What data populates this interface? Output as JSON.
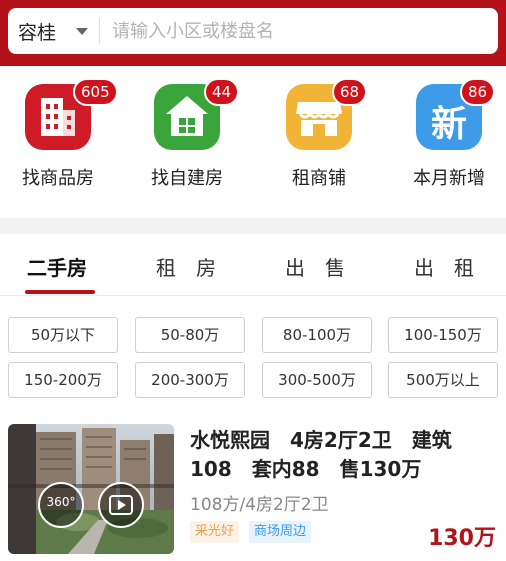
{
  "search": {
    "city": "容桂",
    "placeholder": "请输入小区或楼盘名"
  },
  "categories": [
    {
      "label": "找商品房",
      "count": "605",
      "icon": "building-icon",
      "color": "#cf1b25"
    },
    {
      "label": "找自建房",
      "count": "44",
      "icon": "house-icon",
      "color": "#3aa53b"
    },
    {
      "label": "租商铺",
      "count": "68",
      "icon": "shop-icon",
      "color": "#f1b437"
    },
    {
      "label": "本月新增",
      "count": "86",
      "icon": "new-icon",
      "color": "#3d9be8",
      "icon_text": "新"
    }
  ],
  "tabs": [
    {
      "label": "二手房",
      "active": true
    },
    {
      "label": "租　房"
    },
    {
      "label": "出　售"
    },
    {
      "label": "出　租"
    }
  ],
  "price_filters": [
    "50万以下",
    "50-80万",
    "80-100万",
    "100-150万",
    "150-200万",
    "200-300万",
    "300-500万",
    "500万以上"
  ],
  "listing": {
    "title": "水悦熙园　4房2厅2卫　建筑108　套内88　售130万",
    "subtitle": "108方/4房2厅2卫",
    "tags": [
      {
        "text": "采光好",
        "color": "#f0a04b"
      },
      {
        "text": "商场周边",
        "color": "#3d9be8"
      }
    ],
    "price": "130万",
    "vr_label": "360°"
  }
}
